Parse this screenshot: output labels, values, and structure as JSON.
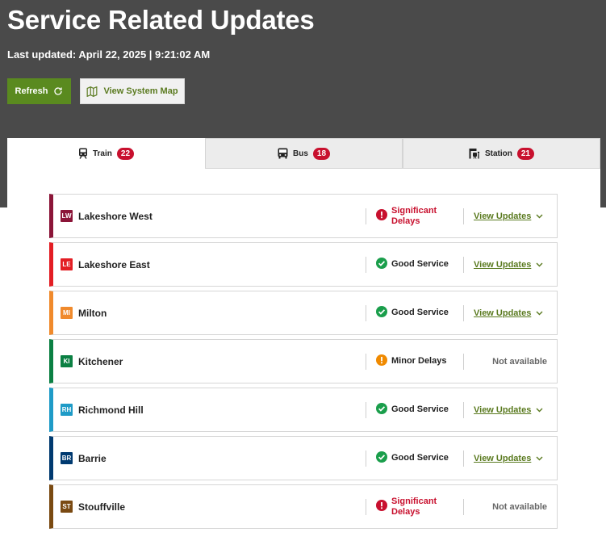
{
  "header": {
    "title": "Service Related Updates",
    "last_updated": "Last updated: April 22, 2025 | 9:21:02 AM",
    "refresh_label": "Refresh",
    "map_label": "View System Map"
  },
  "tabs": [
    {
      "label": "Train",
      "count": "22",
      "icon": "train-icon",
      "active": true
    },
    {
      "label": "Bus",
      "count": "18",
      "icon": "bus-icon",
      "active": false
    },
    {
      "label": "Station",
      "count": "21",
      "icon": "station-icon",
      "active": false
    }
  ],
  "lines": [
    {
      "code": "LW",
      "name": "Lakeshore West",
      "color": "#8b1538",
      "status": "Significant Delays",
      "status_type": "significant",
      "action": "View Updates"
    },
    {
      "code": "LE",
      "name": "Lakeshore East",
      "color": "#e31e24",
      "status": "Good Service",
      "status_type": "good",
      "action": "View Updates"
    },
    {
      "code": "MI",
      "name": "Milton",
      "color": "#f08a2c",
      "status": "Good Service",
      "status_type": "good",
      "action": "View Updates"
    },
    {
      "code": "KI",
      "name": "Kitchener",
      "color": "#0b8043",
      "status": "Minor Delays",
      "status_type": "minor",
      "action": "Not available"
    },
    {
      "code": "RH",
      "name": "Richmond Hill",
      "color": "#1f9bc7",
      "status": "Good Service",
      "status_type": "good",
      "action": "View Updates"
    },
    {
      "code": "BR",
      "name": "Barrie",
      "color": "#003a70",
      "status": "Good Service",
      "status_type": "good",
      "action": "View Updates"
    },
    {
      "code": "ST",
      "name": "Stouffville",
      "color": "#7a4a12",
      "status": "Significant Delays",
      "status_type": "significant",
      "action": "Not available"
    }
  ],
  "colors": {
    "header_bg": "#4a4a4a",
    "accent_green": "#5a8a1f",
    "link_green": "#5a7a1f",
    "badge_red": "#c8102e",
    "good": "#1a9e4b",
    "minor": "#f08a00",
    "significant": "#c8102e"
  }
}
